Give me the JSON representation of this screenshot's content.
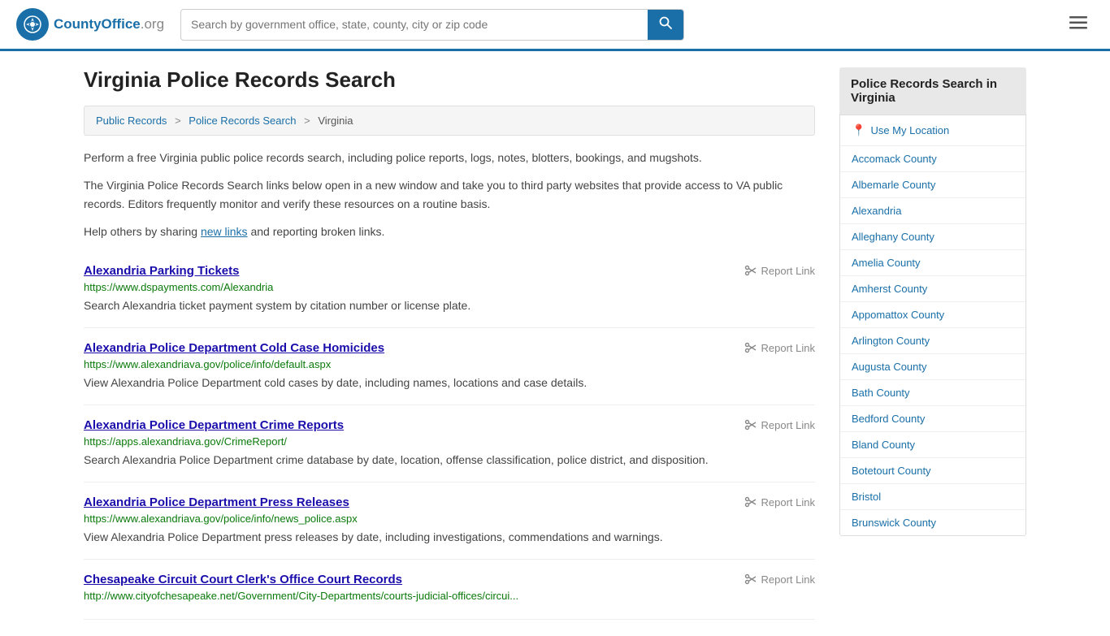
{
  "header": {
    "logo_text": "CountyOffice",
    "logo_tld": ".org",
    "search_placeholder": "Search by government office, state, county, city or zip code"
  },
  "page": {
    "title": "Virginia Police Records Search",
    "breadcrumb": {
      "items": [
        "Public Records",
        "Police Records Search",
        "Virginia"
      ]
    },
    "description1": "Perform a free Virginia public police records search, including police reports, logs, notes, blotters, bookings, and mugshots.",
    "description2": "The Virginia Police Records Search links below open in a new window and take you to third party websites that provide access to VA public records. Editors frequently monitor and verify these resources on a routine basis.",
    "description3_prefix": "Help others by sharing ",
    "description3_link": "new links",
    "description3_suffix": " and reporting broken links."
  },
  "results": [
    {
      "title": "Alexandria Parking Tickets",
      "url": "https://www.dspayments.com/Alexandria",
      "desc": "Search Alexandria ticket payment system by citation number or license plate.",
      "report_label": "Report Link"
    },
    {
      "title": "Alexandria Police Department Cold Case Homicides",
      "url": "https://www.alexandriava.gov/police/info/default.aspx",
      "desc": "View Alexandria Police Department cold cases by date, including names, locations and case details.",
      "report_label": "Report Link"
    },
    {
      "title": "Alexandria Police Department Crime Reports",
      "url": "https://apps.alexandriava.gov/CrimeReport/",
      "desc": "Search Alexandria Police Department crime database by date, location, offense classification, police district, and disposition.",
      "report_label": "Report Link"
    },
    {
      "title": "Alexandria Police Department Press Releases",
      "url": "https://www.alexandriava.gov/police/info/news_police.aspx",
      "desc": "View Alexandria Police Department press releases by date, including investigations, commendations and warnings.",
      "report_label": "Report Link"
    },
    {
      "title": "Chesapeake Circuit Court Clerk's Office Court Records",
      "url": "http://www.cityofchesapeake.net/Government/City-Departments/courts-judicial-offices/circui...",
      "desc": "",
      "report_label": "Report Link"
    }
  ],
  "sidebar": {
    "title": "Police Records Search in Virginia",
    "use_location": "Use My Location",
    "counties": [
      "Accomack County",
      "Albemarle County",
      "Alexandria",
      "Alleghany County",
      "Amelia County",
      "Amherst County",
      "Appomattox County",
      "Arlington County",
      "Augusta County",
      "Bath County",
      "Bedford County",
      "Bland County",
      "Botetourt County",
      "Bristol",
      "Brunswick County"
    ]
  }
}
